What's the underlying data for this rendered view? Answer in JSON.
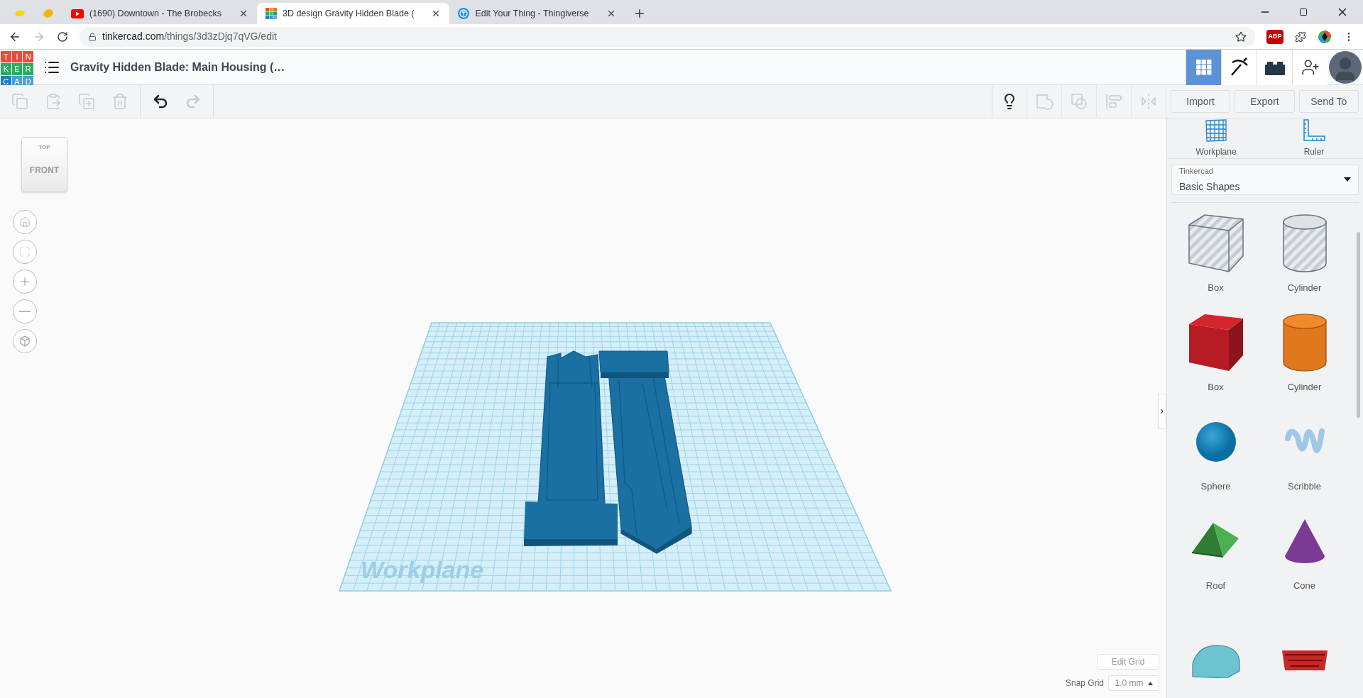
{
  "browser": {
    "tabs": [
      {
        "kind": "yellow",
        "selected": false
      },
      {
        "kind": "lemon",
        "selected": false
      },
      {
        "kind": "youtube",
        "title": "(1690) Downtown - The Brobecks",
        "selected": false
      },
      {
        "kind": "tinkercad",
        "title": "3D design Gravity Hidden Blade (",
        "selected": true
      },
      {
        "kind": "thingiverse",
        "title": "Edit Your Thing - Thingiverse",
        "selected": false
      }
    ],
    "url_host": "tinkercad.com",
    "url_path": "/things/3d3zDjq7qVG/edit",
    "adblock_label": "ABP"
  },
  "app": {
    "logo_letters": [
      "T",
      "I",
      "N",
      "K",
      "E",
      "R",
      "C",
      "A",
      "D"
    ],
    "design_title": "Gravity Hidden Blade: Main Housing (…",
    "views": [
      {
        "kind": "grid",
        "selected": true
      },
      {
        "kind": "pickaxe",
        "selected": false
      },
      {
        "kind": "brick",
        "selected": false
      }
    ]
  },
  "toolbar": {
    "edit_tools": [
      {
        "kind": "copy",
        "disabled": true
      },
      {
        "kind": "paste",
        "disabled": true
      },
      {
        "kind": "duplicate",
        "disabled": true
      },
      {
        "kind": "delete",
        "disabled": true
      }
    ],
    "history_tools": [
      {
        "kind": "undo",
        "disabled": false
      },
      {
        "kind": "redo",
        "disabled": true
      }
    ],
    "shape_tools": [
      {
        "kind": "bulb",
        "disabled": false
      },
      {
        "kind": "shape",
        "disabled": true
      },
      {
        "kind": "group",
        "disabled": true
      },
      {
        "kind": "align",
        "disabled": true
      },
      {
        "kind": "mirror",
        "disabled": true
      }
    ],
    "actions": [
      "Import",
      "Export",
      "Send To"
    ]
  },
  "view_cube": {
    "top": "TOP",
    "front": "FRONT"
  },
  "workplane_label": "Workplane",
  "grid": {
    "edit_button": "Edit Grid",
    "snap_label": "Snap Grid",
    "snap_value": "1.0 mm"
  },
  "panel": {
    "tools": [
      {
        "kind": "workplane",
        "label": "Workplane"
      },
      {
        "kind": "ruler",
        "label": "Ruler"
      }
    ],
    "library": {
      "source": "Tinkercad",
      "category": "Basic Shapes"
    },
    "shapes": [
      {
        "kind": "hole-box",
        "label": "Box"
      },
      {
        "kind": "hole-cylinder",
        "label": "Cylinder"
      },
      {
        "kind": "box",
        "label": "Box"
      },
      {
        "kind": "cylinder",
        "label": "Cylinder"
      },
      {
        "kind": "sphere",
        "label": "Sphere"
      },
      {
        "kind": "scribble",
        "label": "Scribble"
      },
      {
        "kind": "roof",
        "label": "Roof"
      },
      {
        "kind": "cone",
        "label": "Cone"
      },
      {
        "kind": "round-roof"
      },
      {
        "kind": "text"
      }
    ]
  }
}
